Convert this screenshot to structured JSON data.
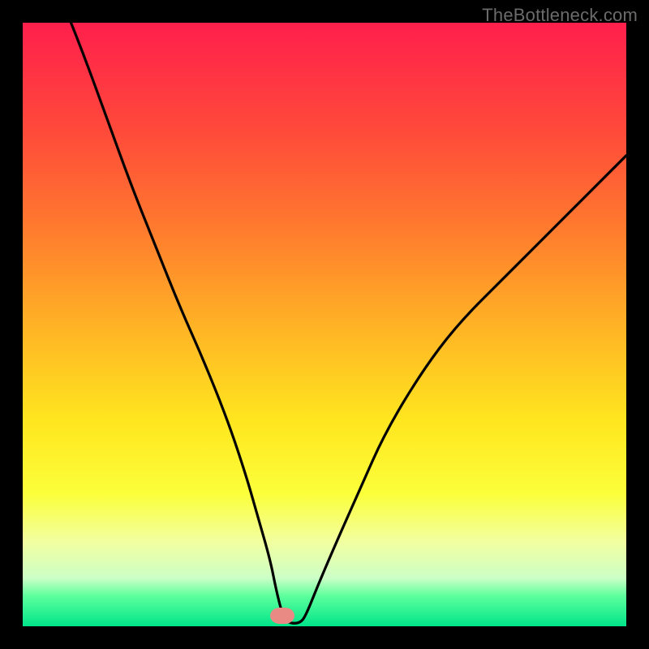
{
  "watermark": "TheBottleneck.com",
  "colors": {
    "frame_bg": "#000000",
    "marker": "#e98a85",
    "curve": "#000000"
  },
  "chart_data": {
    "type": "line",
    "title": "",
    "xlabel": "",
    "ylabel": "",
    "xlim": [
      0,
      100
    ],
    "ylim": [
      0,
      100
    ],
    "grid": false,
    "marker": {
      "x": 43,
      "y": 1.5,
      "color": "#e98a85"
    },
    "background_gradient": {
      "top": "#ff1f4c",
      "mid": "#ffe61f",
      "bottom": "#00e58a"
    },
    "series": [
      {
        "name": "curve",
        "color": "#000000",
        "x": [
          8,
          10,
          14,
          18,
          22,
          26,
          30,
          34,
          37,
          39,
          41,
          42,
          43,
          44,
          46,
          47,
          49,
          52,
          56,
          60,
          66,
          72,
          80,
          88,
          96,
          100
        ],
        "y": [
          100,
          95,
          84,
          73,
          63,
          53,
          44,
          34,
          25,
          18,
          11,
          6,
          2,
          0.5,
          0.5,
          2,
          7,
          14,
          23,
          32,
          42,
          50,
          58,
          66,
          74,
          78
        ]
      }
    ]
  }
}
